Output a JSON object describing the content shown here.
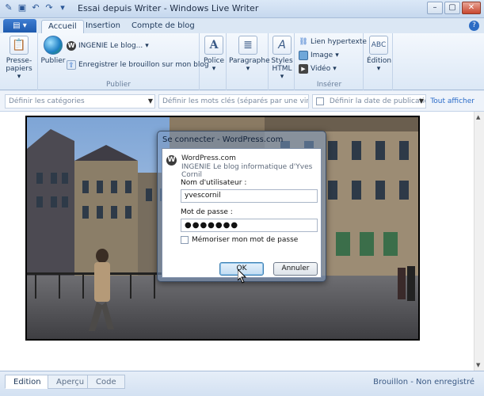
{
  "window": {
    "title": "Essai depuis Writer - Windows Live Writer",
    "controls": [
      "–",
      "▢",
      "✕"
    ]
  },
  "tabs": {
    "app_menu": "▤ ▾",
    "items": [
      "Accueil",
      "Insertion",
      "Compte de blog"
    ],
    "active": "Accueil"
  },
  "ribbon": {
    "clipboard": {
      "label": "Presse-papiers",
      "arrow": "▾"
    },
    "publish": {
      "group_label": "Publier",
      "publish_label": "Publier",
      "blog_selector": "INGENIE Le blog...",
      "save_draft": "Enregistrer le brouillon sur mon blog"
    },
    "font": {
      "label": "Police",
      "arrow": "▾"
    },
    "paragraph": {
      "label": "Paragraphe",
      "arrow": "▾"
    },
    "styles": {
      "label": "Styles HTML",
      "arrow": "▾"
    },
    "insert": {
      "group_label": "Insérer",
      "link": "Lien hypertexte",
      "image": "Image",
      "video": "Vidéo"
    },
    "editing": {
      "label": "Édition",
      "arrow": "▾"
    }
  },
  "options_bar": {
    "categories_placeholder": "Définir les catégories",
    "tags_placeholder": "Définir les mots clés (séparés par une virgule)",
    "date_label": "Définir la date de publication",
    "show_all": "Tout afficher"
  },
  "dialog": {
    "title": "Se connecter - WordPress.com",
    "service": "WordPress.com",
    "blog_name": "INGENIE Le blog informatique d'Yves Cornil",
    "username_label": "Nom d'utilisateur :",
    "username_value": "yvescornil",
    "password_label": "Mot de passe :",
    "password_value": "●●●●●●●",
    "remember_label": "Mémoriser mon mot de passe",
    "ok_label": "OK",
    "cancel_label": "Annuler"
  },
  "status": {
    "view_tabs": [
      "Edition",
      "Aperçu",
      "Code"
    ],
    "active_view": "Edition",
    "draft_status": "Brouillon - Non enregistré"
  }
}
